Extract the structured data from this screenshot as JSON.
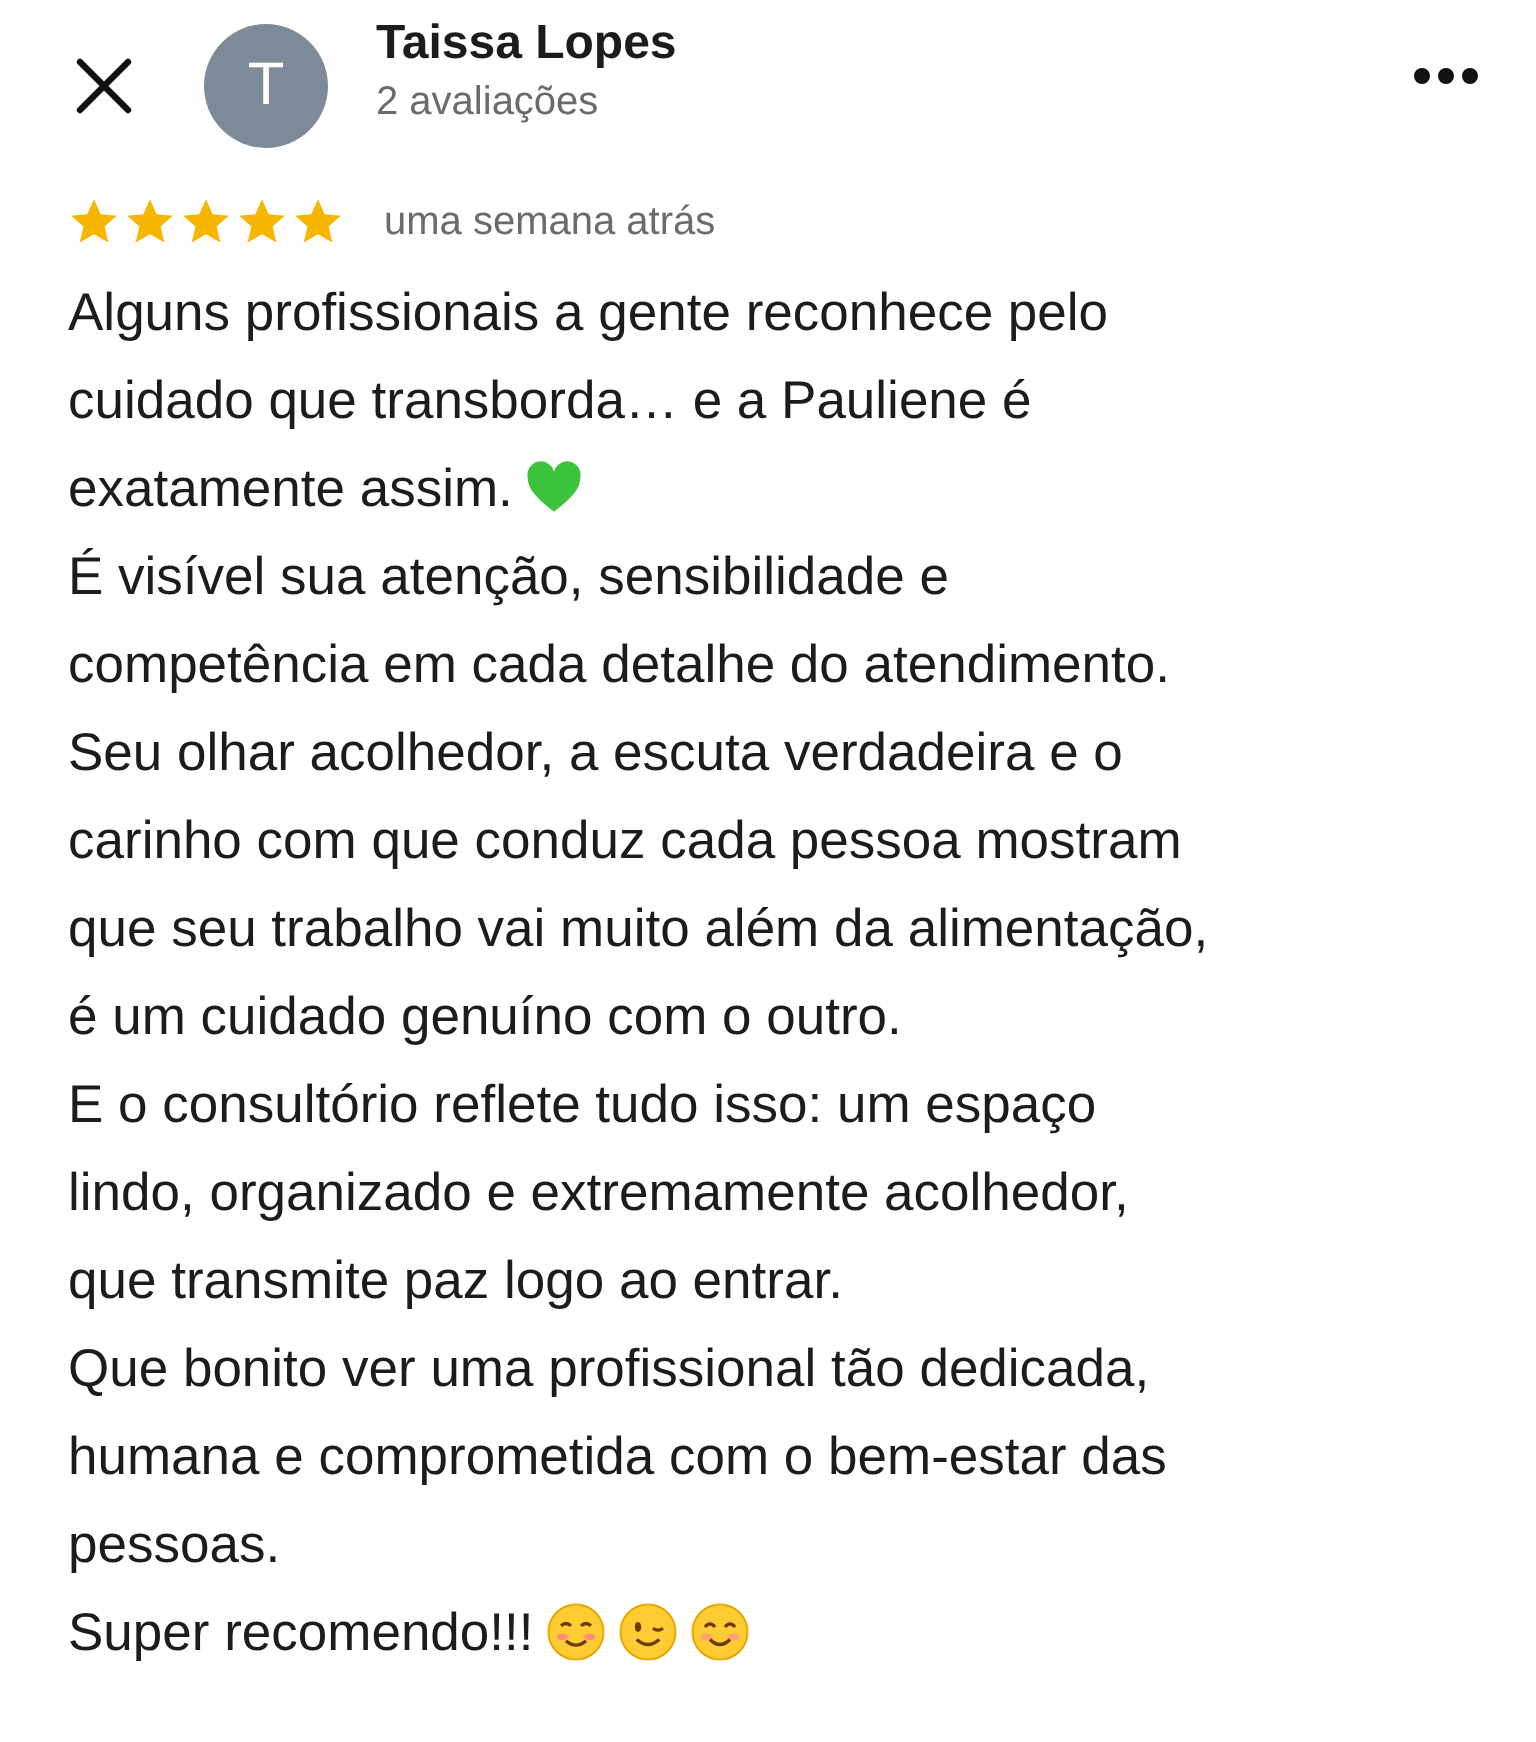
{
  "header": {
    "avatar_letter": "T",
    "name": "Taissa Lopes",
    "subtitle": "2 avaliações"
  },
  "rating": {
    "stars": 5,
    "time": "uma semana atrás"
  },
  "lines": [
    {
      "text": "Alguns profissionais a gente reconhece pelo"
    },
    {
      "text": "cuidado que transborda… e a Pauliene é"
    },
    {
      "text": "exatamente assim.",
      "icons": [
        {
          "kind": "heart"
        }
      ]
    },
    {
      "text": "É visível sua atenção, sensibilidade e"
    },
    {
      "text": "competência em cada detalhe do atendimento."
    },
    {
      "text": "Seu olhar acolhedor, a escuta verdadeira e o"
    },
    {
      "text": "carinho com que conduz cada pessoa mostram"
    },
    {
      "text": "que seu trabalho vai muito além da alimentação,"
    },
    {
      "text": "é um cuidado genuíno com o outro."
    },
    {
      "text": "E o consultório reflete tudo isso: um espaço"
    },
    {
      "text": "lindo, organizado e extremamente acolhedor,"
    },
    {
      "text": "que transmite paz logo ao entrar."
    },
    {
      "text": "Que bonito ver uma profissional tão dedicada,"
    },
    {
      "text": "humana e comprometida com o bem-estar das"
    },
    {
      "text": "pessoas."
    },
    {
      "text": "Super recomendo!!!",
      "icons": [
        {
          "kind": "blush"
        },
        {
          "kind": "wink"
        },
        {
          "kind": "smile"
        }
      ]
    }
  ]
}
